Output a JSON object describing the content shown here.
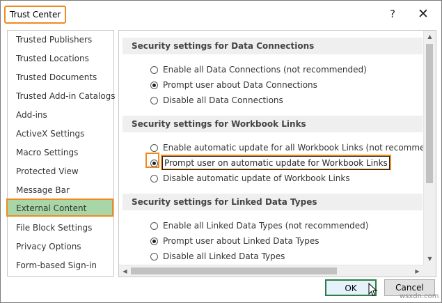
{
  "window": {
    "title": "Trust Center",
    "help": "?",
    "close": "✕"
  },
  "sidebar": {
    "items": [
      "Trusted Publishers",
      "Trusted Locations",
      "Trusted Documents",
      "Trusted Add-in Catalogs",
      "Add-ins",
      "ActiveX Settings",
      "Macro Settings",
      "Protected View",
      "Message Bar",
      "External Content",
      "File Block Settings",
      "Privacy Options",
      "Form-based Sign-in"
    ],
    "selected": "External Content"
  },
  "sections": {
    "data_connections": {
      "header": "Security settings for Data Connections",
      "options": [
        {
          "label": "Enable all Data Connections (not recommended)",
          "checked": false
        },
        {
          "label": "Prompt user about Data Connections",
          "checked": true
        },
        {
          "label": "Disable all Data Connections",
          "checked": false
        }
      ]
    },
    "workbook_links": {
      "header": "Security settings for Workbook Links",
      "options": [
        {
          "label": "Enable automatic update for all Workbook Links (not recommended)",
          "checked": false
        },
        {
          "label": "Prompt user on automatic update for Workbook Links",
          "checked": true
        },
        {
          "label": "Disable automatic update of Workbook Links",
          "checked": false
        }
      ]
    },
    "linked_data_types": {
      "header": "Security settings for Linked Data Types",
      "options": [
        {
          "label": "Enable all Linked Data Types (not recommended)",
          "checked": false
        },
        {
          "label": "Prompt user about Linked Data Types",
          "checked": true
        },
        {
          "label": "Disable all Linked Data Types",
          "checked": false
        }
      ]
    }
  },
  "buttons": {
    "ok": "OK",
    "cancel": "Cancel"
  },
  "watermark": "wsxdn.com",
  "colors": {
    "highlight": "#ef8a1f",
    "selected_bg": "#a9d6a6",
    "ok_border": "#2d7d46"
  }
}
